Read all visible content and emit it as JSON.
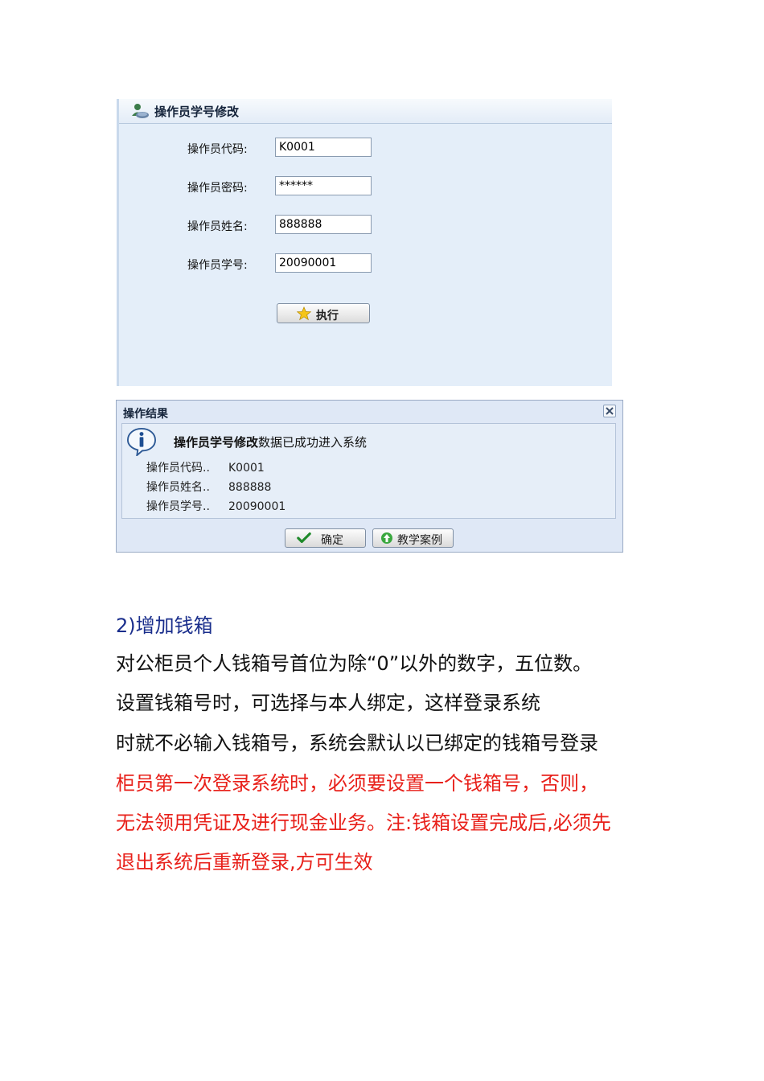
{
  "form": {
    "title": "操作员学号修改",
    "fields": [
      {
        "label": "操作员代码:",
        "value": "K0001"
      },
      {
        "label": "操作员密码:",
        "value": "******"
      },
      {
        "label": "操作员姓名:",
        "value": "888888"
      },
      {
        "label": "操作员学号:",
        "value": "20090001"
      }
    ],
    "execute_label": "执行"
  },
  "dialog": {
    "title": "操作结果",
    "message_bold": "操作员学号修改",
    "message_rest": "数据已成功进入系统",
    "details": [
      {
        "key": "操作员代码..",
        "value": "K0001"
      },
      {
        "key": "操作员姓名..",
        "value": "888888"
      },
      {
        "key": "操作员学号..",
        "value": "20090001"
      }
    ],
    "ok_label": "确定",
    "case_label": "教学案例"
  },
  "section": {
    "heading": "2)增加钱箱",
    "lines": [
      "对公柜员个人钱箱号首位为除“0”以外的数字，五位数。",
      "设置钱箱号时，可选择与本人绑定，这样登录系统",
      "时就不必输入钱箱号，系统会默认以已绑定的钱箱号登录"
    ],
    "red_lines": [
      "柜员第一次登录系统时，必须要设置一个钱箱号，否则，",
      "无法领用凭证及进行现金业务。注:钱箱设置完成后,必须先",
      "退出系统后重新登录,方可生效"
    ]
  },
  "colors": {
    "panel_bg": "#e4eef9",
    "heading": "#1a2e8c",
    "red_text": "#e8201a"
  }
}
